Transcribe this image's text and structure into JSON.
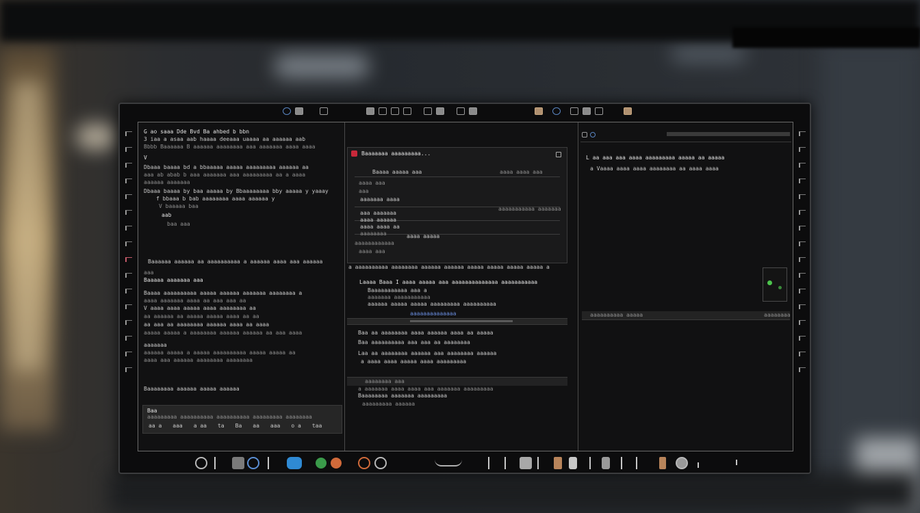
{
  "left_pane": {
    "lines": [
      "G ao saaa  Dde  Bvd  Ba ahbed b bbn",
      "3 iaa a asaa aab  haaaa deeaaa  uaaaa aa aaaaaa  aab",
      "Bbbb  Baaaaaa  B aaaaaa aaaaaaaa aaa aaaaaaa aaaa aaaa",
      "V",
      "Dbaaa baaaa bd  a  bbaaaaa   aaaaa aaaaaaaaa  aaaaaa  aa",
      "  aaa ab abab b  aaa  aaaaaaa  aaa  aaaaaaaaa  aa a  aaaa",
      "  aaaaaa  aaaaaaa",
      "Dbaaa baaaa by baa aaaaa by  Bbaaaaaaaa   bby  aaaaa  y yaaay",
      "  f  bbaaa  b  bab  aaaaaaaa aaaa  aaaaaa y",
      "    V  baaaaa  baa",
      "  aab",
      "    baa aaa",
      "Baaaaaa aaaaaa  aa  aaaaaaaaaa  a aaaaaa  aaaa  aaa  aaaaaa",
      "  aaa",
      "Baaaaa  aaaaaaa  aaa",
      "Baaaa  aaaaaaaaaa  aaaaa aaaaaa  aaaaaaa  aaaaaaaa  a",
      "  aaaa  aaaaaaa aaaa aa  aaa aaa aa",
      "  V  aaaa  aaaa aaaaa  aaaa  aaaaaaaa  aa",
      "  aa  aaaaaa aa aaaaa  aaaaa  aaaa  aa  aa",
      "  aa aaa aa  aaaaaaaa  aaaaaa  aaaa aa  aaaa",
      "  aaaaa  aaaaa  a  aaaaaaaa  aaaaaa aaaaaa  aa  aaa aaaa",
      "  aaaaaaa",
      "  aaaaaa  aaaaa  a  aaaaa  aaaaaaaaaa  aaaaa  aaaaa aa",
      "    aaaa  aaa  aaaaaa  aaaaaaaa  aaaaaaaa"
    ],
    "footer_label": "Baaaaaaaa aaaaaa aaaaa  aaaaaa",
    "status_line1": "Baa",
    "status_line2": "aaaaaaaaa aaaaaaaaaa  aaaaaaaaaa aaaaaaaaa aaaaaaaa",
    "status_values": [
      "aa a",
      "aaa",
      "a aa",
      "ta",
      "Ba",
      "aa",
      "aaa",
      "o a",
      "taa"
    ]
  },
  "mid_pane": {
    "header_title": "Baaaaaaa  aaaaaaaaa...",
    "box_lines": [
      "Baaaa  aaaaa  aaa",
      "aaaa aaa",
      "aaa",
      "aaaaaaa aaaa",
      "aaa aaaaaaa",
      "aaaa aaaaaa",
      "aaaa aaaa aa",
      "aaaaaaaa",
      "aaaaaaaaaaaa",
      "aaaa aaa"
    ],
    "box_right_label": "aaaa aaaa aaa",
    "box_right_label2": "aaaaaaaaaaa aaaaaaa",
    "tab_row": "a aaaaaaaaaa  aaaaaaaa  aaaaaa  aaaaaa  aaaaa  aaaaa  aaaaa  aaaaa  a",
    "section_title": "Laaaa  Baaa  I  aaaa  aaaaa  aaa  aaaaaaaaaaaaaa  aaaaaaaaaaa",
    "section_lines": [
      "Baaaaaaaaaaa  aaa  a",
      "aaaaaaa  aaaaaaaaaaa",
      "aaaaaa  aaaaa  aaaaa  aaaaaaaaa  aaaaaaaaaa"
    ],
    "link": "aaaaaaaaaaaaaa",
    "lower_lines": [
      "Baa  aa  aaaaaaaa aaaa  aaaaaa  aaaa aa  aaaaa",
      "Baa  aaaaaaaaaa  aaa  aaa  aa  aaaaaaaa",
      "Laa  aa  aaaaaaaa  aaaaaa  aaa  aaaaaaaa  aaaaaa",
      "  a  aaaa  aaaa  aaaaa  aaaa  aaaaaaaaa"
    ],
    "bottom_bar_label": "aaaaaaaa aaa",
    "bottom_lines": [
      "Baaaaaaaa  aaaaaaa aaaaaaaaa",
      "  a  aaaaaaa  aaaa  aaaa  aaa  aaaaaaa  aaaaaaaaa",
      "  aaaaaaaaa  aaaaaa"
    ]
  },
  "right_pane": {
    "line1": "L  aa  aaa  aaa  aaaa  aaaaaaaaa  aaaaa  aa  aaaaa",
    "line2": "a  Vaaaa  aaaa  aaaa  aaaaaaaa  aa  aaaa  aaaa",
    "bar_label": "aaaaaaaaaa aaaaa",
    "bar_right": "aaaaaaaa"
  }
}
